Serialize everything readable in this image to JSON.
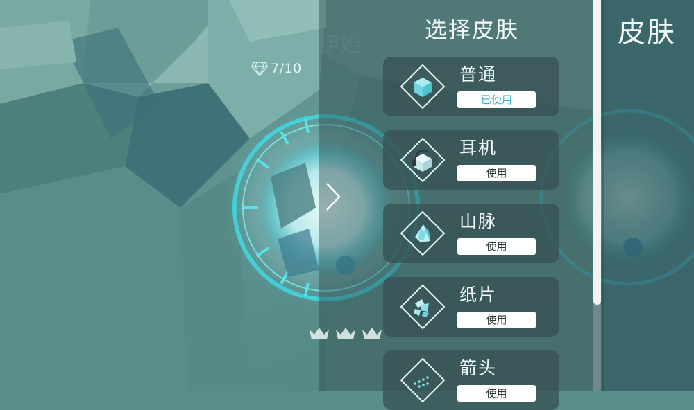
{
  "hud": {
    "gem_icon": "diamond-gem-icon",
    "gem_count": "7/10",
    "crowns": [
      "crown-icon",
      "crown-icon",
      "crown-icon"
    ],
    "next_icon": "chevron-right-icon"
  },
  "skin_panel": {
    "title": "选择皮肤",
    "skins": [
      {
        "name": "普通",
        "button": "已使用",
        "icon": "cube-icon",
        "state": "in-use"
      },
      {
        "name": "耳机",
        "button": "使用",
        "icon": "headphone-cube-icon",
        "state": "available"
      },
      {
        "name": "山脉",
        "button": "使用",
        "icon": "mountain-icon",
        "state": "available"
      },
      {
        "name": "纸片",
        "button": "使用",
        "icon": "paper-pieces-icon",
        "state": "available"
      },
      {
        "name": "箭头",
        "button": "使用",
        "icon": "arrow-dots-icon",
        "state": "available"
      }
    ]
  },
  "right_panel": {
    "title": "皮肤"
  },
  "colors": {
    "accent_cyan": "#2fb2cc",
    "card_bg": "#37525a",
    "scene_teal": "#5b8e8b"
  }
}
